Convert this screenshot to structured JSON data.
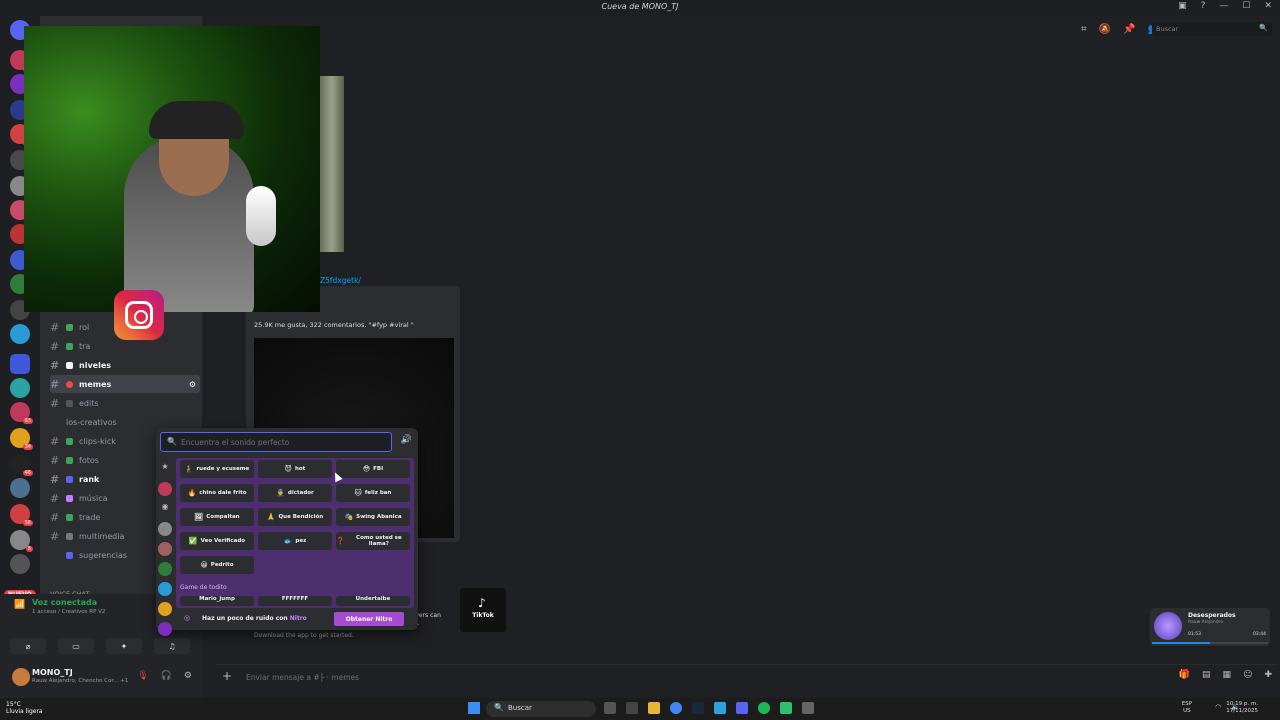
{
  "window": {
    "title": "Cueva de MONO_TJ"
  },
  "header": {
    "search_placeholder": "Buscar"
  },
  "servers": {
    "badges": [
      "21",
      "42",
      "1",
      "63",
      "34",
      "46",
      "56",
      "5",
      "64",
      "36",
      "100"
    ],
    "new_label": "NUEVO"
  },
  "channels": [
    {
      "label": "rol",
      "bold": false
    },
    {
      "label": "tra",
      "bold": false
    },
    {
      "label": "niveles",
      "bold": true
    },
    {
      "label": "memes",
      "bold": true,
      "active": true
    },
    {
      "label": "edits",
      "bold": false
    },
    {
      "label": "los-creativos",
      "bold": false
    },
    {
      "label": "clips-kick",
      "bold": false
    },
    {
      "label": "fotos",
      "bold": false
    },
    {
      "label": "rank",
      "bold": true
    },
    {
      "label": "música",
      "bold": false
    },
    {
      "label": "trade",
      "bold": false
    },
    {
      "label": "multimedia",
      "bold": false
    },
    {
      "label": "sugerencias",
      "bold": false
    }
  ],
  "voice": {
    "header": "VOICE CHAT",
    "status": "Voz conectada",
    "detail": "1 acceso / Creativos RP V2"
  },
  "user": {
    "name": "MONO_TJ",
    "sub": "Rauw Alejandro, Chencho Cor... +1"
  },
  "message": {
    "link": "Z5fdxgetk/",
    "likes": "25.9K me gusta, 322 comentarios. \"#fyp #viral \"",
    "tiktok_label": "TikTok",
    "partial_line1": "wers can",
    "partial_line2": "o.",
    "partial_line3": "Download the app to get started."
  },
  "soundboard": {
    "search_placeholder": "Encuentra el sonido perfecto",
    "sounds": [
      {
        "emoji": "🧎",
        "label": "ruede y ecuseme"
      },
      {
        "emoji": "😈",
        "label": "hot"
      },
      {
        "emoji": "😳",
        "label": "FBI"
      },
      {
        "emoji": "🔥",
        "label": "chino dale frito"
      },
      {
        "emoji": "👮",
        "label": "dictador"
      },
      {
        "emoji": "🐱",
        "label": "feliz ban"
      },
      {
        "emoji": "🖼",
        "label": "Compaltan"
      },
      {
        "emoji": "🙏",
        "label": "Que Bendición"
      },
      {
        "emoji": "🎭",
        "label": "Swing Abanica"
      },
      {
        "emoji": "✅",
        "label": "Veo Verificado"
      },
      {
        "emoji": "🐟",
        "label": "pez"
      },
      {
        "emoji": "❓",
        "label": "Como usted se llama?"
      },
      {
        "emoji": "😀",
        "label": "Pedrito"
      }
    ],
    "category": "Game de todito",
    "partial_sounds": [
      "Mario_jump",
      "FFFFFFF",
      "Undertaibe"
    ],
    "nitro_text": "Haz un poco de ruido con",
    "nitro_word": "Nitro",
    "nitro_button": "Obtener Nitro"
  },
  "chat_input": {
    "placeholder": "Enviar mensaje a #├ · memes"
  },
  "spotify": {
    "title": "Desesperados",
    "artist": "Rauw Alejandro",
    "elapsed": "01:53",
    "total": "03:44",
    "progress": 0.5
  },
  "taskbar": {
    "temp": "15°C",
    "weather": "Lluvia ligera",
    "search": "Buscar",
    "lang1": "ESP",
    "lang2": "US",
    "time": "10:19 p. m.",
    "date": "17/11/2025"
  },
  "colors": {
    "accent": "#5865f2",
    "soundboard_bg": "#4d2e6e",
    "nitro": "#a54cd2",
    "online": "#23a55a"
  }
}
